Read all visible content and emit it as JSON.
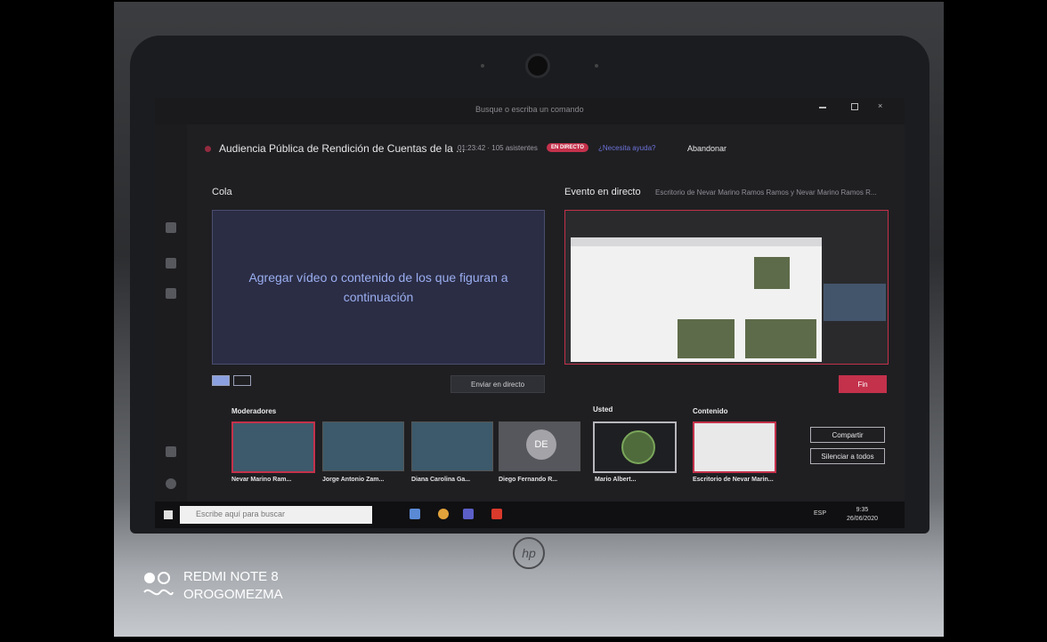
{
  "watermark": {
    "device": "REDMI NOTE 8",
    "user": "OROGOMEZMA"
  },
  "window": {
    "search_placeholder": "Busque o escriba un comando"
  },
  "meeting": {
    "title": "Audiencia Pública de Rendición de Cuentas de la ...",
    "duration": "01:23:42 · 105 asistentes",
    "live_badge": "EN DIRECTO",
    "help_link": "¿Necesita ayuda?",
    "leave_label": "Abandonar"
  },
  "queue": {
    "heading": "Cola",
    "empty_message": "Agregar vídeo o contenido de los que figuran a continuación"
  },
  "live_event": {
    "heading": "Evento en directo",
    "presenter": "Escritorio de Nevar Marino Ramos Ramos y Nevar Marino Ramos R..."
  },
  "controls": {
    "send_live": "Enviar en directo",
    "end": "Fin",
    "share": "Compartir",
    "mute_all": "Silenciar a todos"
  },
  "sections": {
    "moderators": "Moderadores",
    "you": "Usted",
    "content": "Contenido"
  },
  "participants": [
    {
      "name": "Nevar Marino Ram..."
    },
    {
      "name": "Jorge Antonio Zam..."
    },
    {
      "name": "Diana Carolina Ga..."
    },
    {
      "name": "Diego Fernando R...",
      "initials": "DE"
    }
  ],
  "self": {
    "name": "Mario Albert..."
  },
  "content_tile": {
    "name": "Escritorio de Nevar Marin..."
  },
  "taskbar": {
    "search_placeholder": "Escribe aquí para buscar",
    "time": "9:35",
    "date": "26/06/2020",
    "lang": "ESP"
  },
  "colors": {
    "accent": "#c4314b",
    "queue_text": "#9aaef0",
    "teams_bg": "#1f1f22"
  }
}
